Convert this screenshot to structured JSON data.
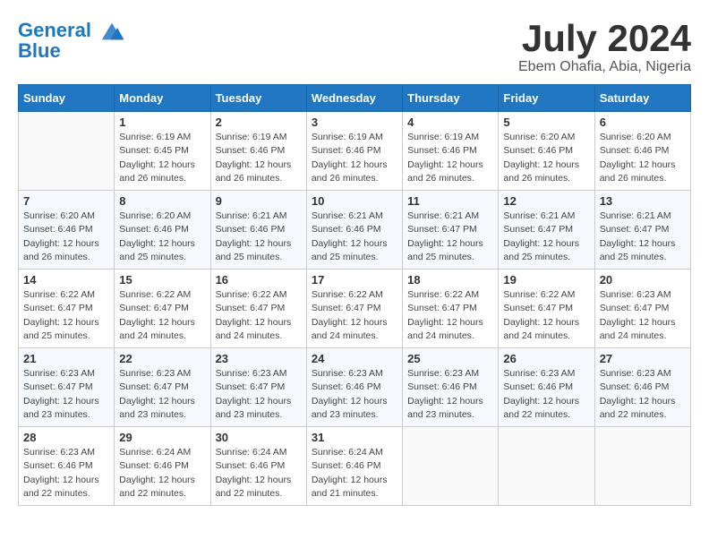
{
  "header": {
    "logo_line1": "General",
    "logo_line2": "Blue",
    "month_title": "July 2024",
    "location": "Ebem Ohafia, Abia, Nigeria"
  },
  "days_of_week": [
    "Sunday",
    "Monday",
    "Tuesday",
    "Wednesday",
    "Thursday",
    "Friday",
    "Saturday"
  ],
  "weeks": [
    [
      {
        "day": "",
        "info": ""
      },
      {
        "day": "1",
        "info": "Sunrise: 6:19 AM\nSunset: 6:45 PM\nDaylight: 12 hours\nand 26 minutes."
      },
      {
        "day": "2",
        "info": "Sunrise: 6:19 AM\nSunset: 6:46 PM\nDaylight: 12 hours\nand 26 minutes."
      },
      {
        "day": "3",
        "info": "Sunrise: 6:19 AM\nSunset: 6:46 PM\nDaylight: 12 hours\nand 26 minutes."
      },
      {
        "day": "4",
        "info": "Sunrise: 6:19 AM\nSunset: 6:46 PM\nDaylight: 12 hours\nand 26 minutes."
      },
      {
        "day": "5",
        "info": "Sunrise: 6:20 AM\nSunset: 6:46 PM\nDaylight: 12 hours\nand 26 minutes."
      },
      {
        "day": "6",
        "info": "Sunrise: 6:20 AM\nSunset: 6:46 PM\nDaylight: 12 hours\nand 26 minutes."
      }
    ],
    [
      {
        "day": "7",
        "info": "Sunrise: 6:20 AM\nSunset: 6:46 PM\nDaylight: 12 hours\nand 26 minutes."
      },
      {
        "day": "8",
        "info": "Sunrise: 6:20 AM\nSunset: 6:46 PM\nDaylight: 12 hours\nand 25 minutes."
      },
      {
        "day": "9",
        "info": "Sunrise: 6:21 AM\nSunset: 6:46 PM\nDaylight: 12 hours\nand 25 minutes."
      },
      {
        "day": "10",
        "info": "Sunrise: 6:21 AM\nSunset: 6:46 PM\nDaylight: 12 hours\nand 25 minutes."
      },
      {
        "day": "11",
        "info": "Sunrise: 6:21 AM\nSunset: 6:47 PM\nDaylight: 12 hours\nand 25 minutes."
      },
      {
        "day": "12",
        "info": "Sunrise: 6:21 AM\nSunset: 6:47 PM\nDaylight: 12 hours\nand 25 minutes."
      },
      {
        "day": "13",
        "info": "Sunrise: 6:21 AM\nSunset: 6:47 PM\nDaylight: 12 hours\nand 25 minutes."
      }
    ],
    [
      {
        "day": "14",
        "info": "Sunrise: 6:22 AM\nSunset: 6:47 PM\nDaylight: 12 hours\nand 25 minutes."
      },
      {
        "day": "15",
        "info": "Sunrise: 6:22 AM\nSunset: 6:47 PM\nDaylight: 12 hours\nand 24 minutes."
      },
      {
        "day": "16",
        "info": "Sunrise: 6:22 AM\nSunset: 6:47 PM\nDaylight: 12 hours\nand 24 minutes."
      },
      {
        "day": "17",
        "info": "Sunrise: 6:22 AM\nSunset: 6:47 PM\nDaylight: 12 hours\nand 24 minutes."
      },
      {
        "day": "18",
        "info": "Sunrise: 6:22 AM\nSunset: 6:47 PM\nDaylight: 12 hours\nand 24 minutes."
      },
      {
        "day": "19",
        "info": "Sunrise: 6:22 AM\nSunset: 6:47 PM\nDaylight: 12 hours\nand 24 minutes."
      },
      {
        "day": "20",
        "info": "Sunrise: 6:23 AM\nSunset: 6:47 PM\nDaylight: 12 hours\nand 24 minutes."
      }
    ],
    [
      {
        "day": "21",
        "info": "Sunrise: 6:23 AM\nSunset: 6:47 PM\nDaylight: 12 hours\nand 23 minutes."
      },
      {
        "day": "22",
        "info": "Sunrise: 6:23 AM\nSunset: 6:47 PM\nDaylight: 12 hours\nand 23 minutes."
      },
      {
        "day": "23",
        "info": "Sunrise: 6:23 AM\nSunset: 6:47 PM\nDaylight: 12 hours\nand 23 minutes."
      },
      {
        "day": "24",
        "info": "Sunrise: 6:23 AM\nSunset: 6:46 PM\nDaylight: 12 hours\nand 23 minutes."
      },
      {
        "day": "25",
        "info": "Sunrise: 6:23 AM\nSunset: 6:46 PM\nDaylight: 12 hours\nand 23 minutes."
      },
      {
        "day": "26",
        "info": "Sunrise: 6:23 AM\nSunset: 6:46 PM\nDaylight: 12 hours\nand 22 minutes."
      },
      {
        "day": "27",
        "info": "Sunrise: 6:23 AM\nSunset: 6:46 PM\nDaylight: 12 hours\nand 22 minutes."
      }
    ],
    [
      {
        "day": "28",
        "info": "Sunrise: 6:23 AM\nSunset: 6:46 PM\nDaylight: 12 hours\nand 22 minutes."
      },
      {
        "day": "29",
        "info": "Sunrise: 6:24 AM\nSunset: 6:46 PM\nDaylight: 12 hours\nand 22 minutes."
      },
      {
        "day": "30",
        "info": "Sunrise: 6:24 AM\nSunset: 6:46 PM\nDaylight: 12 hours\nand 22 minutes."
      },
      {
        "day": "31",
        "info": "Sunrise: 6:24 AM\nSunset: 6:46 PM\nDaylight: 12 hours\nand 21 minutes."
      },
      {
        "day": "",
        "info": ""
      },
      {
        "day": "",
        "info": ""
      },
      {
        "day": "",
        "info": ""
      }
    ]
  ]
}
